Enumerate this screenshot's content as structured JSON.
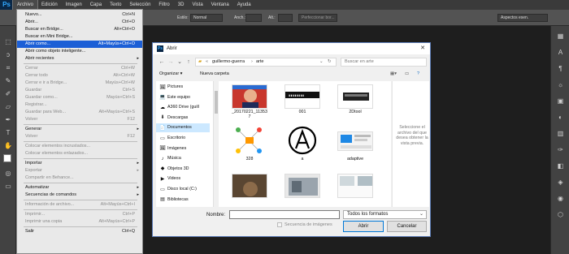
{
  "app": {
    "logo": "Ps"
  },
  "menubar": {
    "items": [
      "Archivo",
      "Edición",
      "Imagen",
      "Capa",
      "Texto",
      "Selección",
      "Filtro",
      "3D",
      "Vista",
      "Ventana",
      "Ayuda"
    ]
  },
  "options": {
    "style_label": "Estilo:",
    "style_value": "Normal",
    "width_label": "Anch.:",
    "height_label": "Alt.:",
    "refine": "Perfeccionar bor...",
    "workspace": "Aspectos esen."
  },
  "file_menu": {
    "items": [
      {
        "label": "Nuevo...",
        "shortcut": "Ctrl+N",
        "state": "normal"
      },
      {
        "label": "Abrir...",
        "shortcut": "Ctrl+O",
        "state": "normal"
      },
      {
        "label": "Buscar en Bridge...",
        "shortcut": "Alt+Ctrl+O",
        "state": "normal"
      },
      {
        "label": "Buscar en Mini Bridge...",
        "shortcut": "",
        "state": "normal"
      },
      {
        "label": "Abrir como...",
        "shortcut": "Alt+Mayús+Ctrl+O",
        "state": "highlight"
      },
      {
        "label": "Abrir como objeto inteligente...",
        "shortcut": "",
        "state": "normal"
      },
      {
        "label": "Abrir recientes",
        "shortcut": "",
        "state": "submenu"
      },
      {
        "sep": true
      },
      {
        "label": "Cerrar",
        "shortcut": "Ctrl+W",
        "state": "disabled"
      },
      {
        "label": "Cerrar todo",
        "shortcut": "Alt+Ctrl+W",
        "state": "disabled"
      },
      {
        "label": "Cerrar e ir a Bridge...",
        "shortcut": "Mayús+Ctrl+W",
        "state": "disabled"
      },
      {
        "label": "Guardar",
        "shortcut": "Ctrl+S",
        "state": "disabled"
      },
      {
        "label": "Guardar como...",
        "shortcut": "Mayús+Ctrl+S",
        "state": "disabled"
      },
      {
        "label": "Registrar...",
        "shortcut": "",
        "state": "disabled"
      },
      {
        "label": "Guardar para Web...",
        "shortcut": "Alt+Mayús+Ctrl+S",
        "state": "disabled"
      },
      {
        "label": "Volver",
        "shortcut": "F12",
        "state": "disabled"
      },
      {
        "sep": true
      },
      {
        "label": "Generar",
        "shortcut": "",
        "state": "submenu"
      },
      {
        "label": "Volver",
        "shortcut": "F12",
        "state": "disabled"
      },
      {
        "sep": true
      },
      {
        "label": "Colocar elementos incrustados...",
        "shortcut": "",
        "state": "disabled"
      },
      {
        "label": "Colocar elementos enlazados...",
        "shortcut": "",
        "state": "disabled"
      },
      {
        "sep": true
      },
      {
        "label": "Importar",
        "shortcut": "",
        "state": "submenu"
      },
      {
        "label": "Exportar",
        "shortcut": "",
        "state": "submenu-disabled"
      },
      {
        "label": "Compartir en Behance...",
        "shortcut": "",
        "state": "disabled"
      },
      {
        "sep": true
      },
      {
        "label": "Automatizar",
        "shortcut": "",
        "state": "submenu"
      },
      {
        "label": "Secuencias de comandos",
        "shortcut": "",
        "state": "submenu"
      },
      {
        "sep": true
      },
      {
        "label": "Información de archivo...",
        "shortcut": "Alt+Mayús+Ctrl+I",
        "state": "disabled"
      },
      {
        "sep": true
      },
      {
        "label": "Imprimir...",
        "shortcut": "Ctrl+P",
        "state": "disabled"
      },
      {
        "label": "Imprimir una copia",
        "shortcut": "Alt+Mayús+Ctrl+P",
        "state": "disabled"
      },
      {
        "sep": true
      },
      {
        "label": "Salir",
        "shortcut": "Ctrl+Q",
        "state": "normal"
      }
    ]
  },
  "dialog": {
    "title": "Abrir",
    "close": "✕",
    "path": [
      "guillermo-guerra",
      "arte"
    ],
    "search_placeholder": "Buscar en arte",
    "organize": "Organizar ▾",
    "new_folder": "Nueva carpeta",
    "nav": [
      {
        "label": "Pictures",
        "icon": "🖼"
      },
      {
        "label": "Este equipo",
        "icon": "💻"
      },
      {
        "label": "A360 Drive (guill",
        "icon": "☁"
      },
      {
        "label": "Descargas",
        "icon": "⬇"
      },
      {
        "label": "Documentos",
        "icon": "📄",
        "selected": true
      },
      {
        "label": "Escritorio",
        "icon": "▭"
      },
      {
        "label": "Imágenes",
        "icon": "🖼"
      },
      {
        "label": "Música",
        "icon": "♪"
      },
      {
        "label": "Objetos 3D",
        "icon": "◆"
      },
      {
        "label": "Videos",
        "icon": "▶"
      },
      {
        "label": "Disco local (C:)",
        "icon": "▭"
      },
      {
        "label": "Bibliotecas",
        "icon": "▤"
      }
    ],
    "files": [
      {
        "name": "_20170221_11353\n7"
      },
      {
        "name": "001"
      },
      {
        "name": "2Dtool"
      },
      {
        "name": "328"
      },
      {
        "name": "a"
      },
      {
        "name": "adaptive"
      },
      {
        "name": ""
      },
      {
        "name": ""
      },
      {
        "name": ""
      }
    ],
    "preview_text": "Seleccione el archivo del que desea obtener la vista previa.",
    "filename_label": "Nombre:",
    "filename_value": "",
    "filetype": "Todos los formatos",
    "sequence_label": "Secuencia de imágenes",
    "open_button": "Abrir",
    "cancel_button": "Cancelar"
  }
}
